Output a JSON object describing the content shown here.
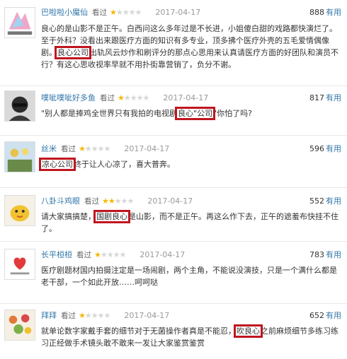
{
  "reviews": [
    {
      "user": "巴啦啦小魔仙",
      "watched": "看过",
      "rating": 1,
      "date": "2017-04-17",
      "useful_count": "888",
      "useful_label": "有用",
      "content": {
        "pre": "良心的是山影不是正午。白西问这么多年过是不长进，小姐傻白甜的戏路都快演烂了。至于外科？没看出来跟医疗方面的知识有多专业，顶多拂个医疗外壳的五毛爱情偶像剧。",
        "hl": "良心公司",
        "post": "出轨风云炒作和刷评分的那点心思用来认真请医疗方面的好团队和演员不行？有这心思收视率早就不用扑街靠营销了，负分不谢。"
      }
    },
    {
      "user": "噗呲噗呲好多鱼",
      "watched": "看过",
      "rating": 1,
      "date": "2017-04-17",
      "useful_count": "817",
      "useful_label": "有用",
      "content": {
        "pre": "\"别人都是捧鸡全世界只有我拍的电视剧",
        "hl": "良心\"公司",
        "post": "\"你怕了吗?"
      }
    },
    {
      "user": "丝米",
      "watched": "看过",
      "rating": 1,
      "date": "2017-04-17",
      "useful_count": "596",
      "useful_label": "有用",
      "content": {
        "pre": "",
        "hl": "凉心公司",
        "post": "终于让人心凉了，喜大普奔。"
      }
    },
    {
      "user": "八卦斗鸡眼",
      "watched": "看过",
      "rating": 2,
      "date": "2017-04-17",
      "useful_count": "552",
      "useful_label": "有用",
      "content": {
        "pre": "请大家搞搞楚，",
        "hl": "国剧良心",
        "post": "是山影，而不是正午。再这么作下去，正午的遮羞布快挂不住了。"
      }
    },
    {
      "user": "长平桓桓",
      "watched": "看过",
      "rating": 1,
      "date": "2017-04-17",
      "useful_count": "783",
      "useful_label": "有用",
      "content": {
        "pre": "医疗剧题材国内拍摄注定是一场闹剧，两个主角，不能说没演技，只是一个满什么都是老干部，一个如此开放……呵呵哒",
        "hl": "",
        "post": ""
      }
    },
    {
      "user": "拜拜",
      "watched": "看过",
      "rating": 1,
      "date": "2017-04-17",
      "useful_count": "652",
      "useful_label": "有用",
      "content": {
        "pre": "就单论数字家戴手套的细节对于无菌操作者真是不能忍，",
        "hl": "吹良心",
        "post": "之前麻烦细节多练习练习正经做手术镜头敢不敢来一发让大家鉴赏鉴赏"
      }
    }
  ],
  "colors": {
    "link": "#3377aa",
    "star": "#f6b900",
    "highlight_box": "#c0151f"
  }
}
